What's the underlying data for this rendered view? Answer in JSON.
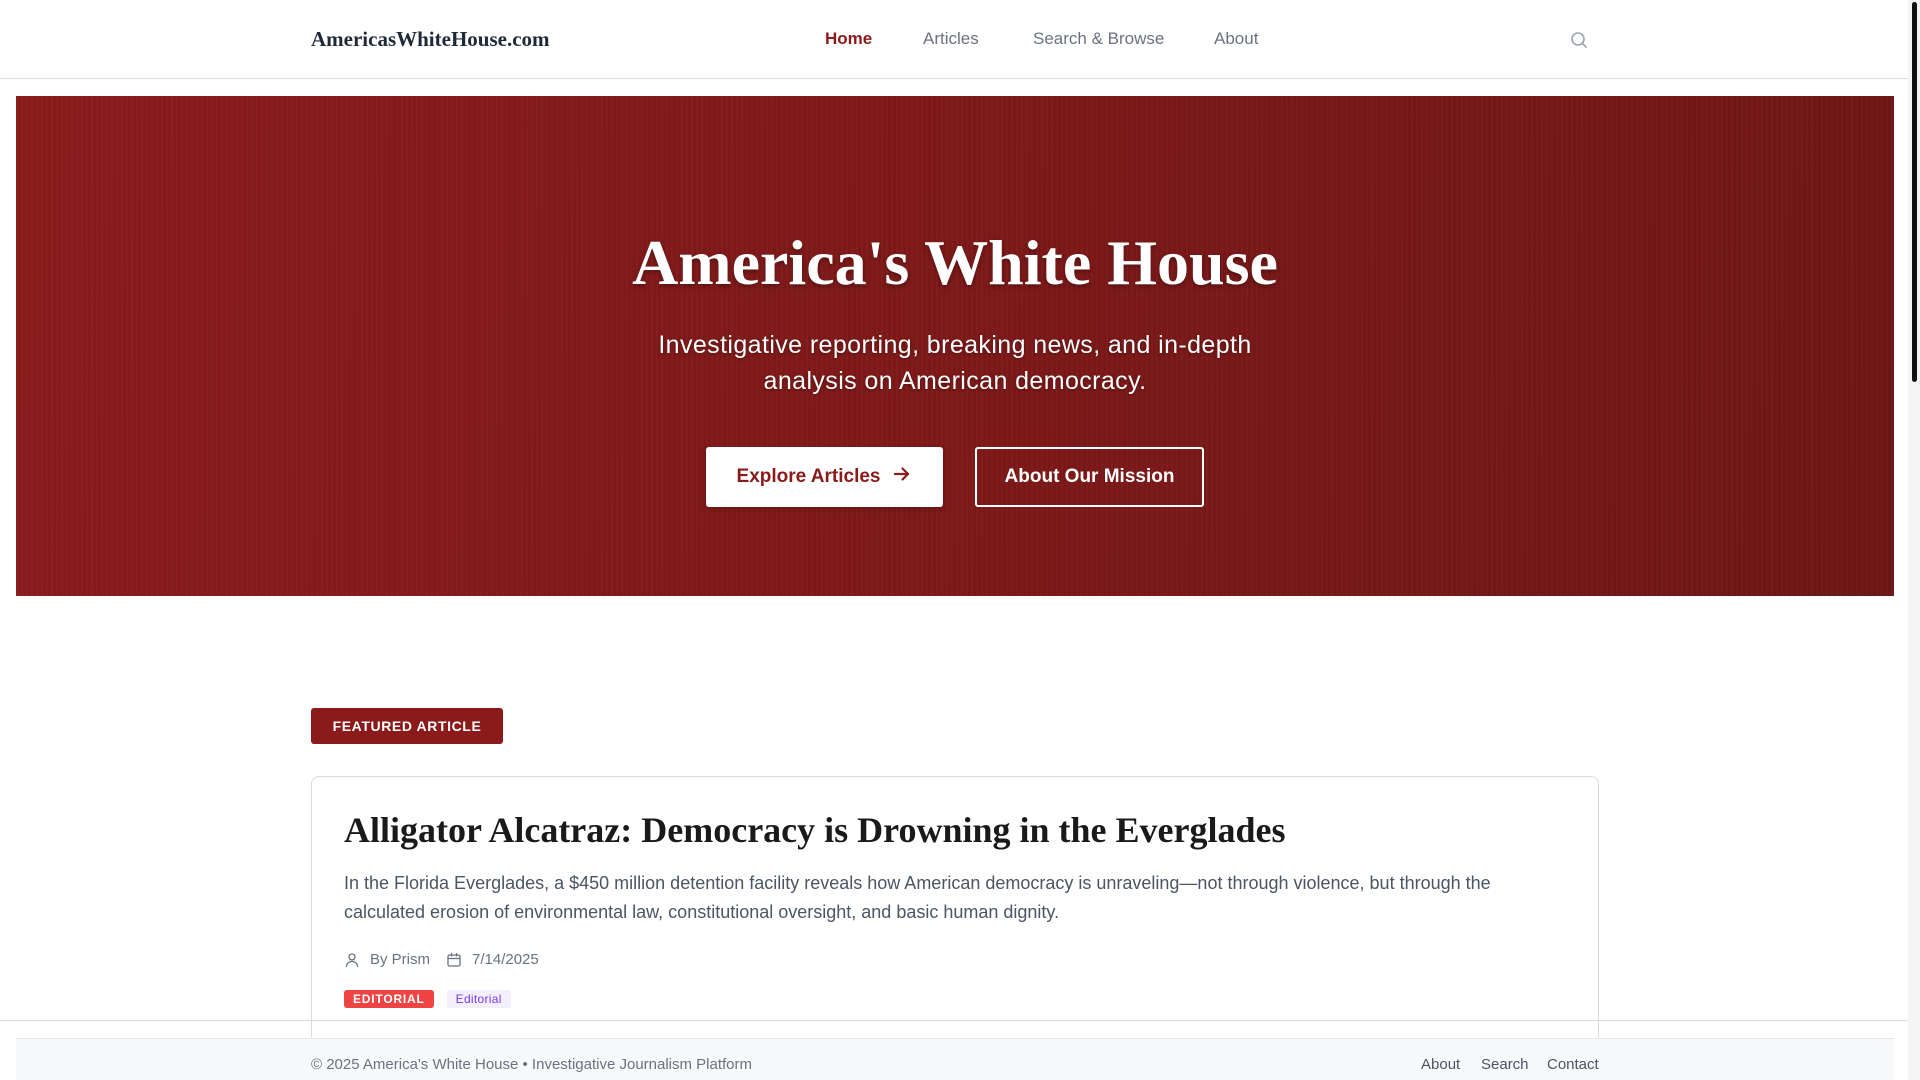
{
  "header": {
    "brand": "AmericasWhiteHouse.com",
    "nav": {
      "home": "Home",
      "articles": "Articles",
      "search_browse": "Search & Browse",
      "about": "About"
    },
    "active_item": "Home"
  },
  "hero": {
    "title": "America's White House",
    "subtitle": "Investigative reporting, breaking news, and in-depth analysis on American democracy.",
    "primary_button": "Explore Articles",
    "secondary_button": "About Our Mission"
  },
  "featured": {
    "badge": "FEATURED ARTICLE",
    "title": "Alligator Alcatraz: Democracy is Drowning in the Everglades",
    "excerpt": "In the Florida Everglades, a $450 million detention facility reveals how American democracy is unraveling—not through violence, but through the calculated erosion of environmental law, constitutional oversight, and basic human dignity.",
    "author": "By Prism",
    "date": "7/14/2025",
    "tags": {
      "category": "EDITORIAL",
      "label": "Editorial"
    }
  },
  "footer": {
    "copyright": "© 2025 America's White House • Investigative Journalism Platform",
    "links": {
      "about": "About",
      "search": "Search",
      "contact": "Contact"
    }
  },
  "colors": {
    "accent": "#8b1a1a",
    "hero_background": "#7c1818",
    "tag_red": "#ef4444",
    "tag_purple": "#7c3aed"
  },
  "icons": {
    "search": "search-icon",
    "arrow": "arrow-right-icon",
    "author": "user-icon",
    "date": "calendar-icon"
  }
}
